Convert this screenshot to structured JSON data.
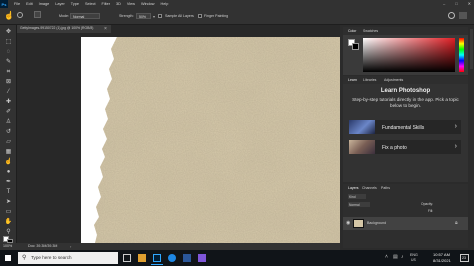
{
  "menubar": {
    "logo": "Ps",
    "items": [
      "File",
      "Edit",
      "Image",
      "Layer",
      "Type",
      "Select",
      "Filter",
      "3D",
      "View",
      "Window",
      "Help"
    ],
    "window_controls": [
      "–",
      "□",
      "✕"
    ]
  },
  "options_bar": {
    "mode_label": "Mode:",
    "mode_value": "Normal",
    "strength_label": "Strength:",
    "strength_value": "50%",
    "sample_all_layers": "Sample All Layers",
    "finger_painting": "Finger Painting"
  },
  "document_tab": {
    "title": "GettyImages-99150722 (1).jpg @ 100% (RGB/8)",
    "close": "×"
  },
  "status_bar": {
    "zoom": "100%",
    "doc_size": "Doc: 39.3M/39.3M"
  },
  "color_panel": {
    "tabs": [
      "Color",
      "Swatches"
    ],
    "foreground_color": "#ffffff",
    "background_color": "#000000",
    "hue_color": "#e01e24"
  },
  "learn_panel": {
    "tabs": [
      "Learn",
      "Libraries",
      "Adjustments"
    ],
    "title": "Learn Photoshop",
    "description": "Step-by-step tutorials directly in the app. Pick a topic below to begin.",
    "cards": [
      {
        "label": "Fundamental Skills",
        "chevron": "›"
      },
      {
        "label": "Fix a photo",
        "chevron": "›"
      }
    ]
  },
  "layers_panel": {
    "tabs": [
      "Layers",
      "Channels",
      "Paths"
    ],
    "kind_label": "Kind",
    "blend_mode": "Normal",
    "opacity_label": "Opacity:",
    "fill_label": "Fill:",
    "layer_name": "Background"
  },
  "taskbar": {
    "search_placeholder": "Type here to search",
    "time": "10:57 AM",
    "date": "8/31/2021",
    "language": "ENG",
    "region": "US",
    "notification_count": "23"
  },
  "colors": {
    "app_dark": "#282828",
    "panel": "#323232",
    "texture_base": "#d6c8a8",
    "accent_blue": "#31a8ff"
  }
}
